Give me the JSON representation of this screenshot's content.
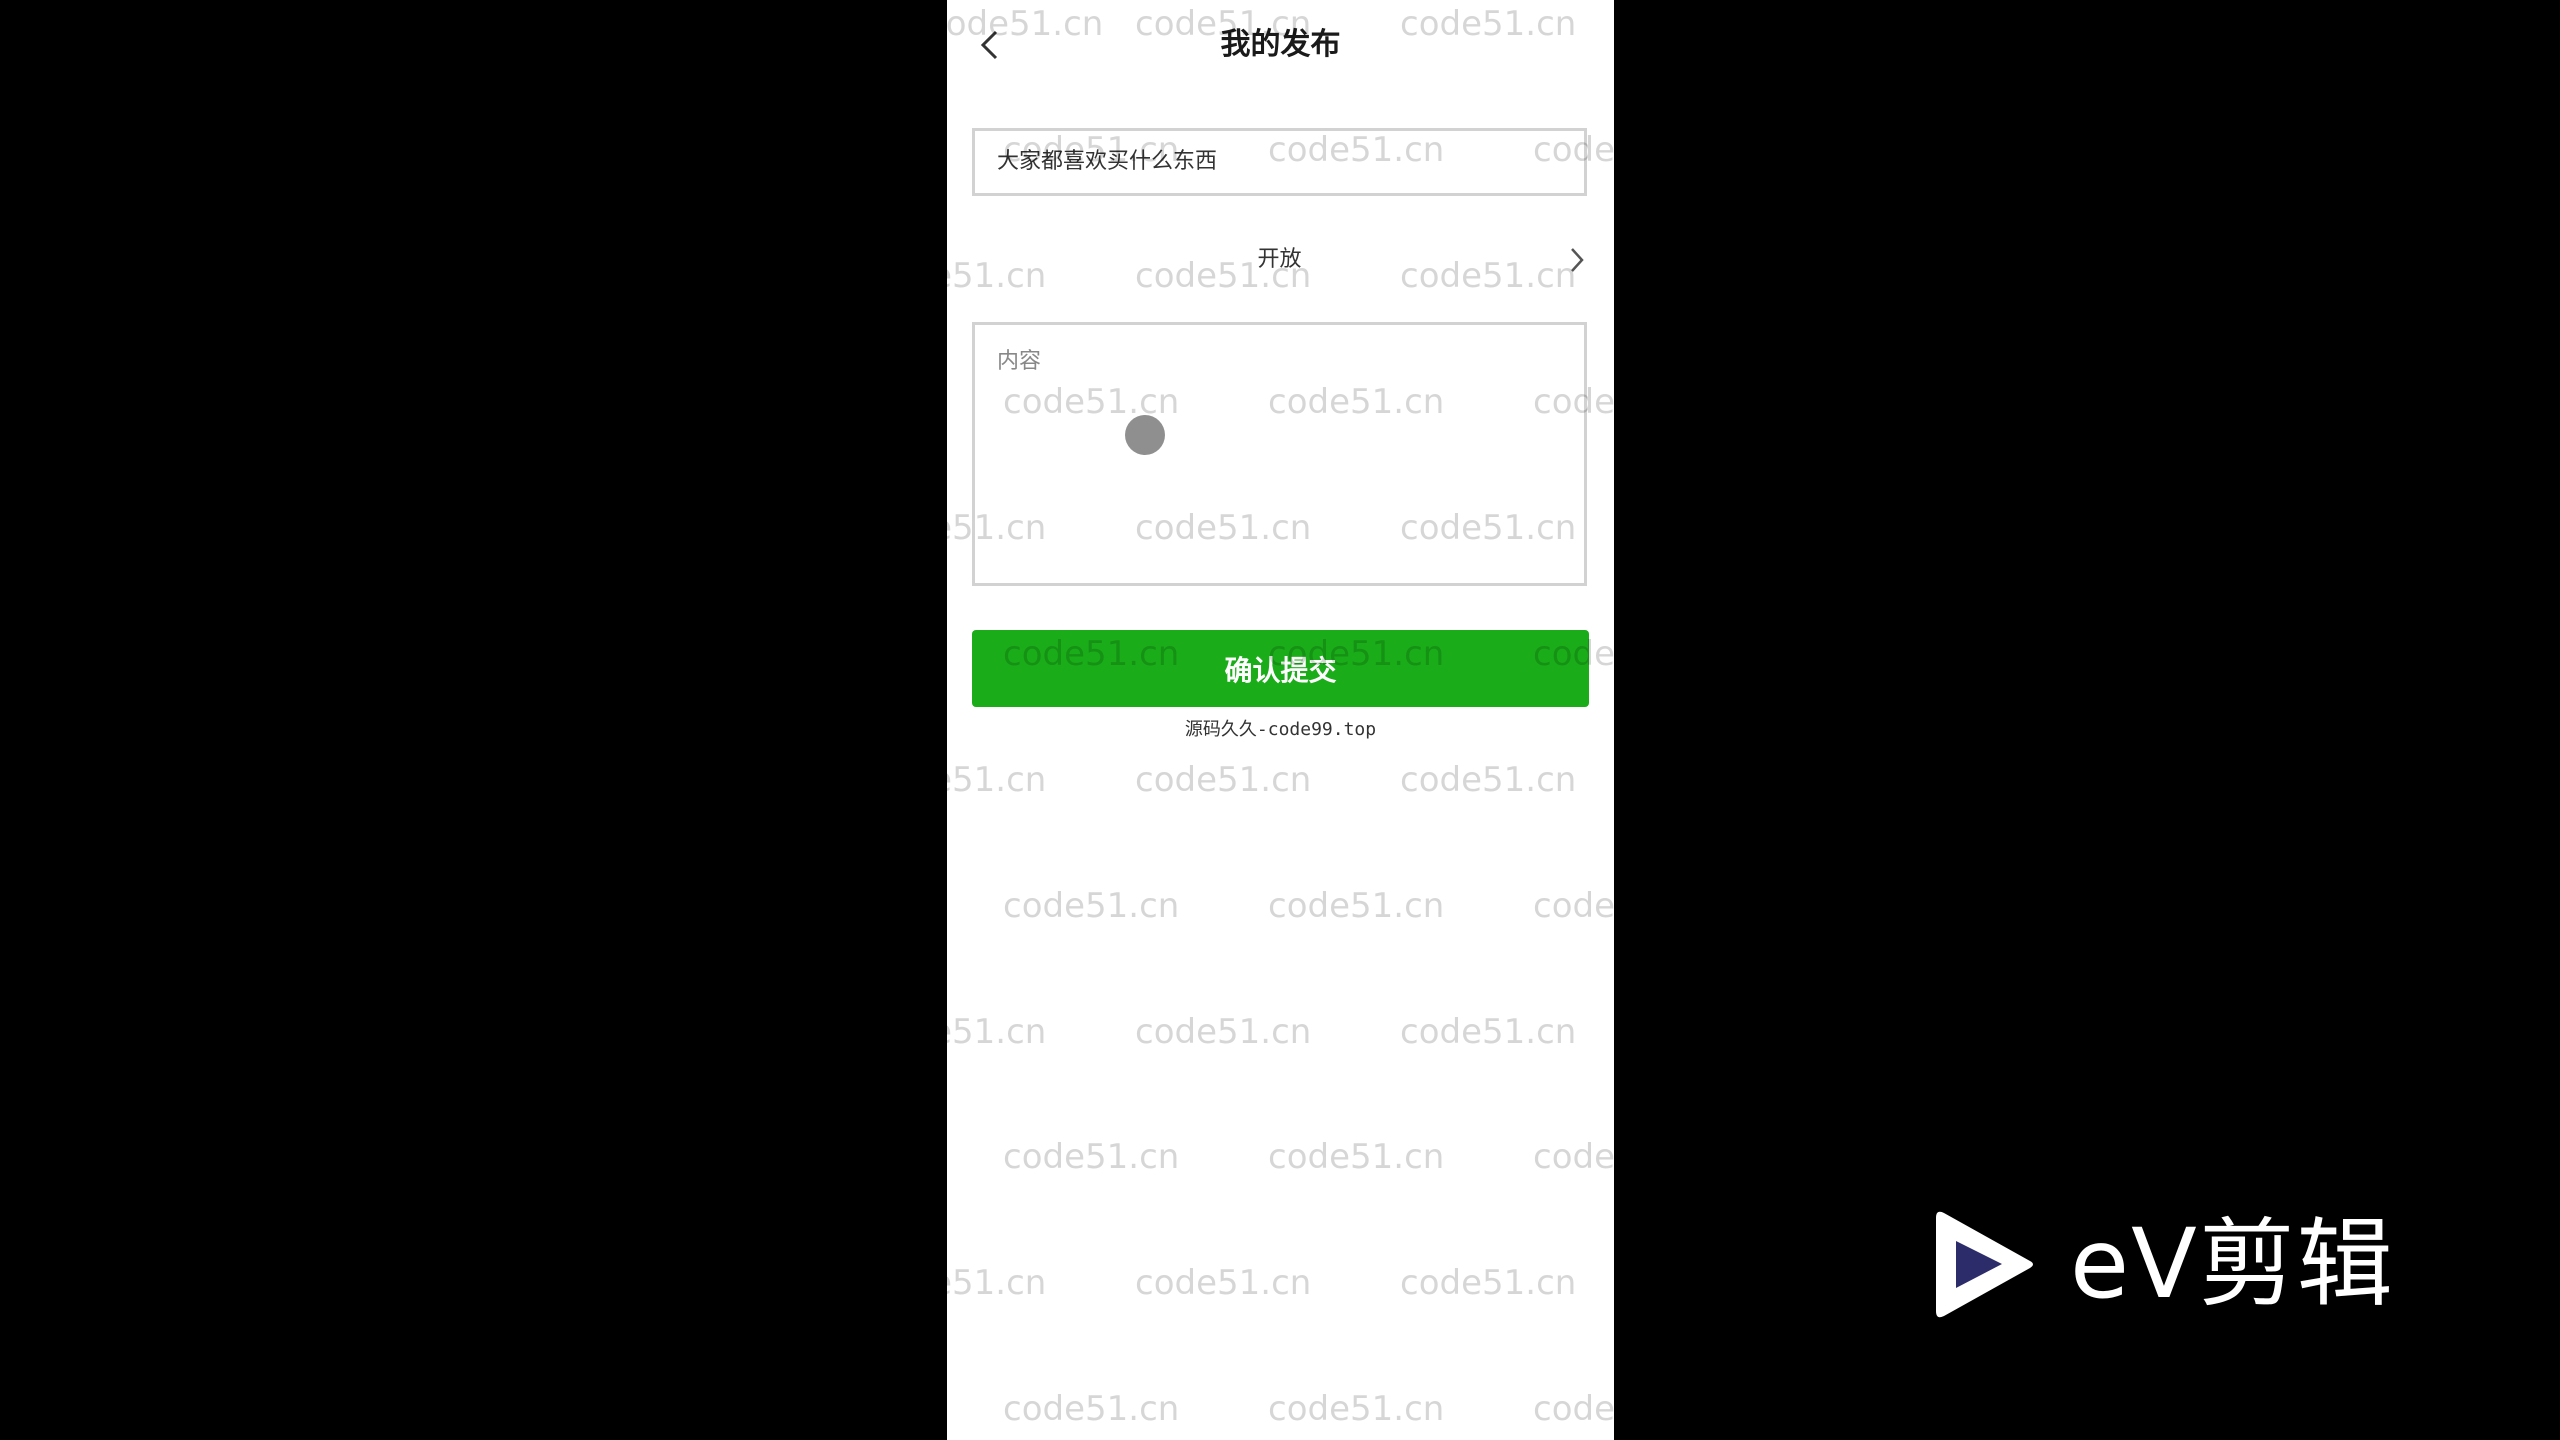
{
  "header": {
    "title": "我的发布",
    "back_icon": "chevron-left-icon"
  },
  "form": {
    "title_value": "大家都喜欢买什么东西",
    "visibility_value": "开放",
    "visibility_icon": "chevron-right-icon",
    "content_placeholder": "内容",
    "submit_label": "确认提交",
    "submit_color": "#1aad19"
  },
  "footer": {
    "text": "源码久久-code99.top"
  },
  "watermark": {
    "text": "code51.cn"
  },
  "overlay_logo": {
    "text": "eV剪辑",
    "icon": "play-icon"
  }
}
